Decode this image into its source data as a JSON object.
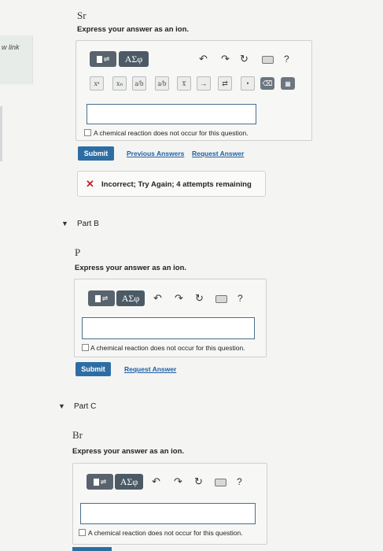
{
  "side": {
    "link_text": "w link"
  },
  "partA": {
    "symbol": "Sr",
    "prompt": "Express your answer as an ion.",
    "toolbar": {
      "template_icon": "template-icon",
      "greek_label": "ΑΣφ",
      "help_label": "?"
    },
    "keys": [
      "xᵃ",
      "xₙ",
      "a/b",
      "a/b",
      "x̅",
      "→",
      "⇄",
      "•"
    ],
    "checkbox_label": "A chemical reaction does not occur for this question.",
    "submit_label": "Submit",
    "previous_answers_label": "Previous Answers",
    "request_answer_label": "Request Answer",
    "feedback": "Incorrect; Try Again; 4 attempts remaining"
  },
  "partB": {
    "title": "Part B",
    "symbol": "P",
    "prompt": "Express your answer as an ion.",
    "greek_label": "ΑΣφ",
    "help_label": "?",
    "checkbox_label": "A chemical reaction does not occur for this question.",
    "submit_label": "Submit",
    "request_answer_label": "Request Answer"
  },
  "partC": {
    "title": "Part C",
    "symbol": "Br",
    "prompt": "Express your answer as an ion.",
    "greek_label": "ΑΣφ",
    "help_label": "?",
    "checkbox_label": "A chemical reaction does not occur for this question."
  },
  "colors": {
    "accent": "#2e6da4",
    "error": "#c0262d",
    "toolbar": "#4c5a66"
  }
}
